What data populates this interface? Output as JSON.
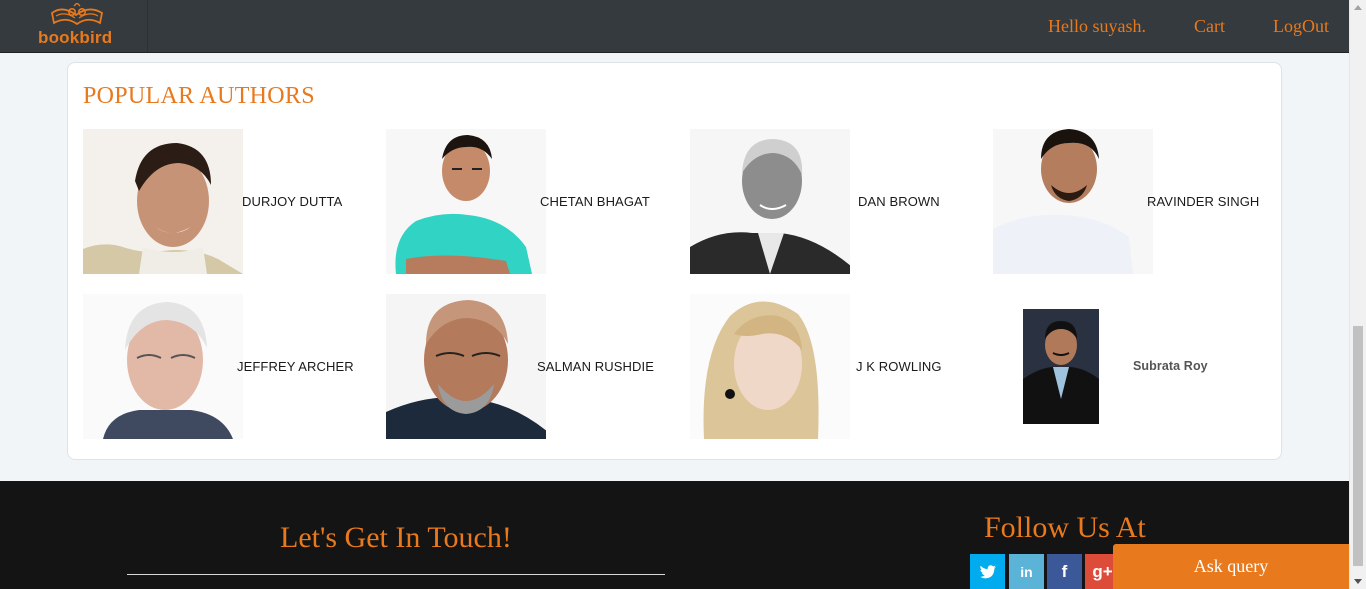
{
  "brand": {
    "logo_text": "bookbird",
    "logo_icon": "owl-book-icon",
    "accent": "#e8791d"
  },
  "nav": {
    "greeting": "Hello suyash.",
    "cart": "Cart",
    "logout": "LogOut"
  },
  "authors": {
    "title": "POPULAR AUTHORS",
    "items": [
      {
        "name": "DURJOY DUTTA"
      },
      {
        "name": "CHETAN BHAGAT"
      },
      {
        "name": "DAN BROWN"
      },
      {
        "name": "RAVINDER SINGH"
      },
      {
        "name": "JEFFREY ARCHER"
      },
      {
        "name": "SALMAN RUSHDIE"
      },
      {
        "name": "J K ROWLING"
      },
      {
        "name": "Subrata Roy"
      }
    ]
  },
  "footer": {
    "touch_title": "Let's Get In Touch!",
    "follow_title": "Follow Us At",
    "social": [
      {
        "icon": "twitter-icon",
        "glyph": "t",
        "color": "#00aced"
      },
      {
        "icon": "linkedin-icon",
        "glyph": "in",
        "color": "#5bb4d8"
      },
      {
        "icon": "facebook-icon",
        "glyph": "f",
        "color": "#3b5998"
      },
      {
        "icon": "google-plus-icon",
        "glyph": "g+",
        "color": "#dd4b39"
      }
    ]
  },
  "ask_query": "Ask query"
}
